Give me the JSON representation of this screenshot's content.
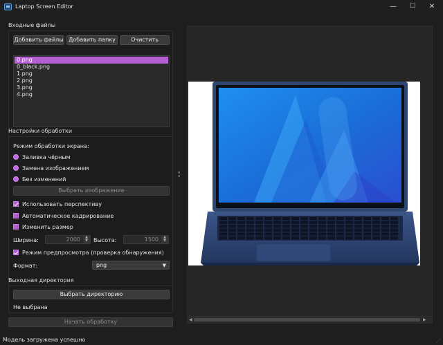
{
  "window": {
    "title": "Laptop Screen Editor",
    "min": "—",
    "max": "☐",
    "close": "✕"
  },
  "input_files": {
    "section_title": "Входные файлы",
    "add_files": "Добавить файлы",
    "add_folder": "Добавить папку",
    "clear": "Очистить",
    "files": [
      "0.png",
      "0_black.png",
      "1.png",
      "2.png",
      "3.png",
      "4.png"
    ],
    "selected_index": 0
  },
  "processing": {
    "section_title": "Настройки обработки",
    "mode_label": "Режим обработки экрана:",
    "modes": [
      "Заливка чёрным",
      "Замена изображением",
      "Без изменений"
    ],
    "choose_image": "Выбрать изображение",
    "use_perspective": "Использовать перспективу",
    "auto_crop": "Автоматическое кадрирование",
    "resize": "Изменить размер",
    "width_label": "Ширина:",
    "width_value": "2000",
    "height_label": "Высота:",
    "height_value": "1500",
    "preview_mode": "Режим предпросмотра (проверка обнаружения)",
    "format_label": "Формат:",
    "format_value": "png"
  },
  "output": {
    "section_title": "Выходная директория",
    "choose_dir": "Выбрать директорию",
    "dir_value": "Не выбрана"
  },
  "start_button": "Начать обработку",
  "status": "Модель загружена успешно",
  "colors": {
    "accent": "#b45fd1",
    "background": "#1e1e1e",
    "screen_blue": "#1a7fe0"
  },
  "preview_image": "laptop-photo"
}
